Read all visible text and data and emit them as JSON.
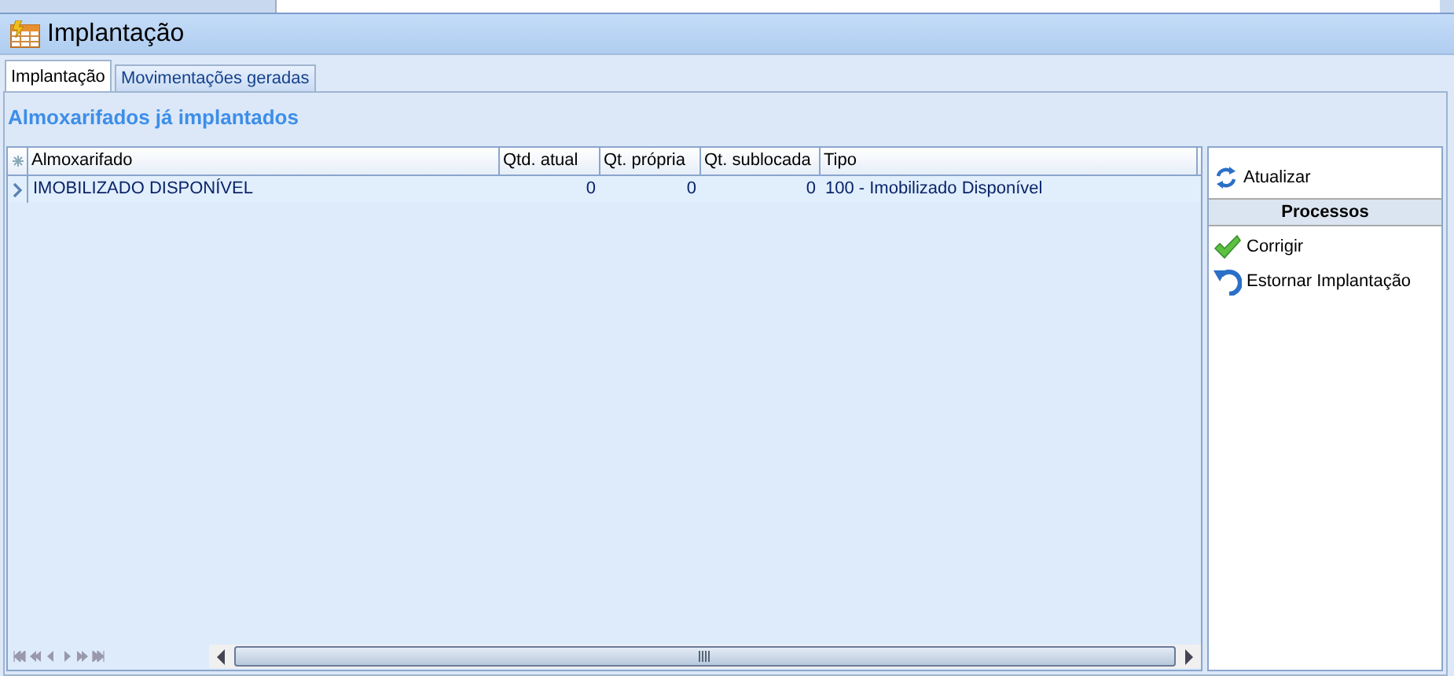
{
  "window": {
    "title": "Implantação"
  },
  "tabs": [
    {
      "label": "Implantação",
      "selected": true
    },
    {
      "label": "Movimentações geradas",
      "selected": false
    }
  ],
  "section_title": "Almoxarifados já implantados",
  "grid": {
    "columns": [
      {
        "label": "Almoxarifado"
      },
      {
        "label": "Qtd. atual"
      },
      {
        "label": "Qt. própria"
      },
      {
        "label": "Qt. sublocada"
      },
      {
        "label": "Tipo"
      }
    ],
    "rows": [
      {
        "cells": [
          "IMOBILIZADO DISPONÍVEL",
          "0",
          "0",
          "0",
          "100 - Imobilizado Disponível"
        ],
        "selected": true
      }
    ]
  },
  "actions": [
    {
      "kind": "action",
      "label": "Atualizar"
    },
    {
      "kind": "header",
      "label": "Processos"
    },
    {
      "kind": "action",
      "label": "Corrigir"
    },
    {
      "kind": "action",
      "label": "Estornar Implantação"
    }
  ]
}
